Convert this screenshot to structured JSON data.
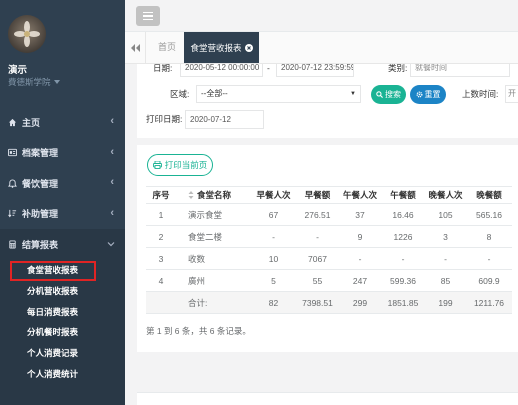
{
  "sidebar": {
    "user": {
      "name": "演示",
      "org": "費德斯学院"
    },
    "menu": [
      {
        "label": "主页",
        "icon": "home-icon"
      },
      {
        "label": "档案管理",
        "icon": "id-card-icon"
      },
      {
        "label": "餐饮管理",
        "icon": "bell-icon"
      },
      {
        "label": "补助管理",
        "icon": "sort-amount-icon"
      },
      {
        "label": "结算报表",
        "icon": "calculator-icon"
      }
    ],
    "report_items": [
      "食堂营收报表",
      "分机营收报表",
      "每日消费报表",
      "分机餐时报表",
      "个人消费记录",
      "个人消费统计"
    ]
  },
  "tabs": {
    "home": "首页",
    "active": "食堂营收报表"
  },
  "filters": {
    "date_label": "日期:",
    "date_start": "2020-05-12 00:00:00",
    "date_sep": "-",
    "date_end": "2020-07-12 23:59:59",
    "category_label": "类别:",
    "category_value": "就餐时间",
    "area_label": "区域:",
    "area_value": "--全部--",
    "search_label": "搜索",
    "reset_label": "重置",
    "upload_time_label": "上数时间:",
    "upload_time_value": "开",
    "print_date_label": "打印日期:",
    "print_date_value": "2020-07-12"
  },
  "table": {
    "print_label": "打印当前页",
    "columns": [
      "序号",
      "食堂名称",
      "早餐人次",
      "早餐额",
      "午餐人次",
      "午餐额",
      "晚餐人次",
      "晚餐额"
    ],
    "rows": [
      [
        "1",
        "演示食堂",
        "67",
        "276.51",
        "37",
        "16.46",
        "105",
        "565.16"
      ],
      [
        "2",
        "食堂二楼",
        "-",
        "-",
        "9",
        "1226",
        "3",
        "8"
      ],
      [
        "3",
        "收数",
        "10",
        "7067",
        "-",
        "-",
        "-",
        "-"
      ],
      [
        "4",
        "廣州",
        "5",
        "55",
        "247",
        "599.36",
        "85",
        "609.9"
      ]
    ],
    "footer": {
      "label": "合计:",
      "values": [
        "82",
        "7398.51",
        "299",
        "1851.85",
        "199",
        "1211.76"
      ]
    }
  },
  "pagination": "第 1 到 6 条，共 6 条记录。",
  "colors": {
    "sidebar_bg": "#2f4050",
    "primary": "#1ab394",
    "info": "#1c84c6",
    "highlight": "#e02424"
  }
}
